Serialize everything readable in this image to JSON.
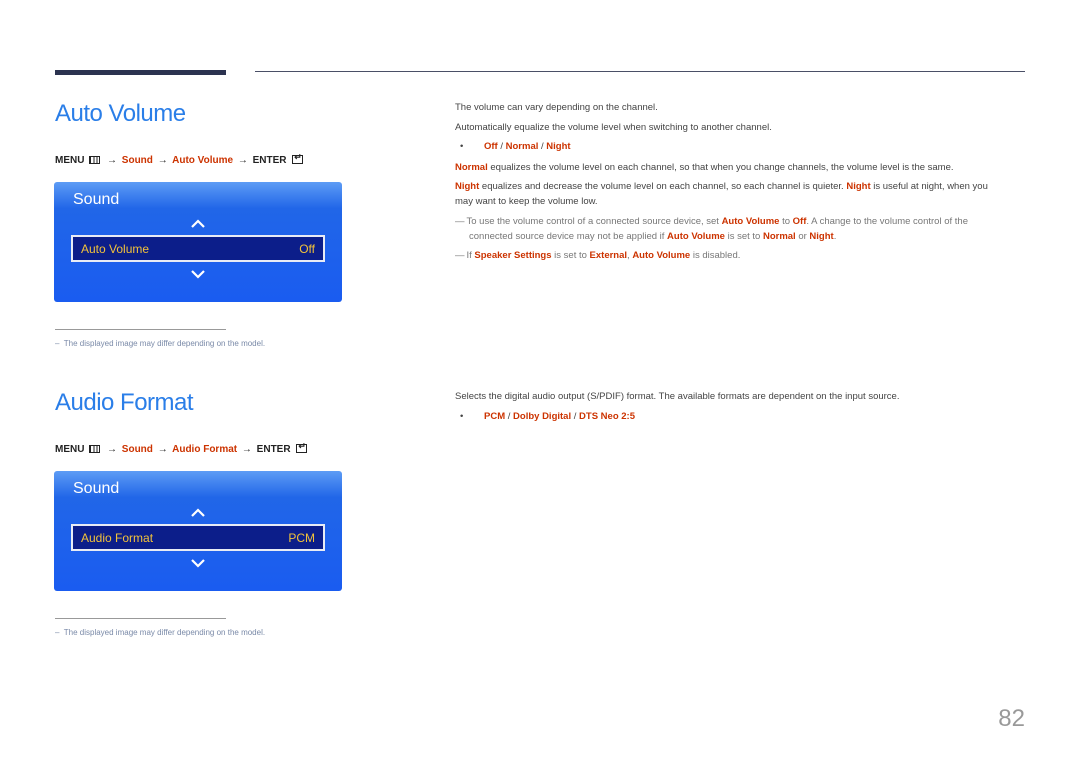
{
  "sections": {
    "auto_volume": {
      "title": "Auto Volume",
      "menu_path": {
        "menu": "MENU",
        "menu_icon": "menu-icon",
        "arrow": "→",
        "step1": "Sound",
        "step2": "Auto Volume",
        "enter": "ENTER",
        "enter_icon": "enter-icon"
      },
      "osd": {
        "title": "Sound",
        "item_label": "Auto Volume",
        "item_value": "Off",
        "up_icon": "chevron-up-icon",
        "down_icon": "chevron-down-icon"
      },
      "footnote": "The displayed image may differ depending on the model.",
      "description": [
        "The volume can vary depending on the channel.",
        "Automatically equalize the volume level when switching to another channel."
      ],
      "options": [
        "Off",
        "Normal",
        "Night"
      ],
      "option_separator": " / ",
      "explanations": {
        "normal": {
          "term": "Normal",
          "text": " equalizes the volume level on each channel, so that when you change channels, the volume level is the same."
        },
        "night": {
          "term": "Night",
          "text1": " equalizes and decrease the volume level on each channel, so each channel is quieter. ",
          "term2": "Night",
          "text2": " is useful at night, when you",
          "text3": "may want to keep the volume low."
        }
      },
      "notes": {
        "note1": {
          "t1": "To use the volume control of a connected source device, set ",
          "b1": "Auto Volume",
          "t2": " to ",
          "b2": "Off",
          "t3": ". A change to the volume control of the",
          "t4": "connected source device may not be applied if ",
          "b3": "Auto Volume",
          "t5": " is set to ",
          "b4": "Normal",
          "t6": " or ",
          "b5": "Night",
          "t7": "."
        },
        "note2": {
          "t1": "If ",
          "b1": "Speaker Settings",
          "t2": " is set to ",
          "b2": "External",
          "t3": ", ",
          "b3": "Auto Volume",
          "t4": " is disabled."
        }
      }
    },
    "audio_format": {
      "title": "Audio Format",
      "menu_path": {
        "menu": "MENU",
        "menu_icon": "menu-icon",
        "arrow": "→",
        "step1": "Sound",
        "step2": "Audio Format",
        "enter": "ENTER",
        "enter_icon": "enter-icon"
      },
      "osd": {
        "title": "Sound",
        "item_label": "Audio Format",
        "item_value": "PCM",
        "up_icon": "chevron-up-icon",
        "down_icon": "chevron-down-icon"
      },
      "footnote": "The displayed image may differ depending on the model.",
      "description": "Selects the digital audio output (S/PDIF) format. The available formats are dependent on the input source.",
      "options": [
        "PCM",
        "Dolby Digital",
        "DTS Neo 2:5"
      ],
      "option_separator": " / "
    }
  },
  "bullet_char": "•",
  "note_dash": "―",
  "footnote_dash": "–",
  "page_number": "82",
  "colors": {
    "title_blue": "#2a7ee8",
    "accent_red": "#cc3300",
    "osd_blue": "#1a5cf0",
    "osd_item_bg": "#0c1e8a",
    "osd_item_text": "#f3c23a"
  }
}
